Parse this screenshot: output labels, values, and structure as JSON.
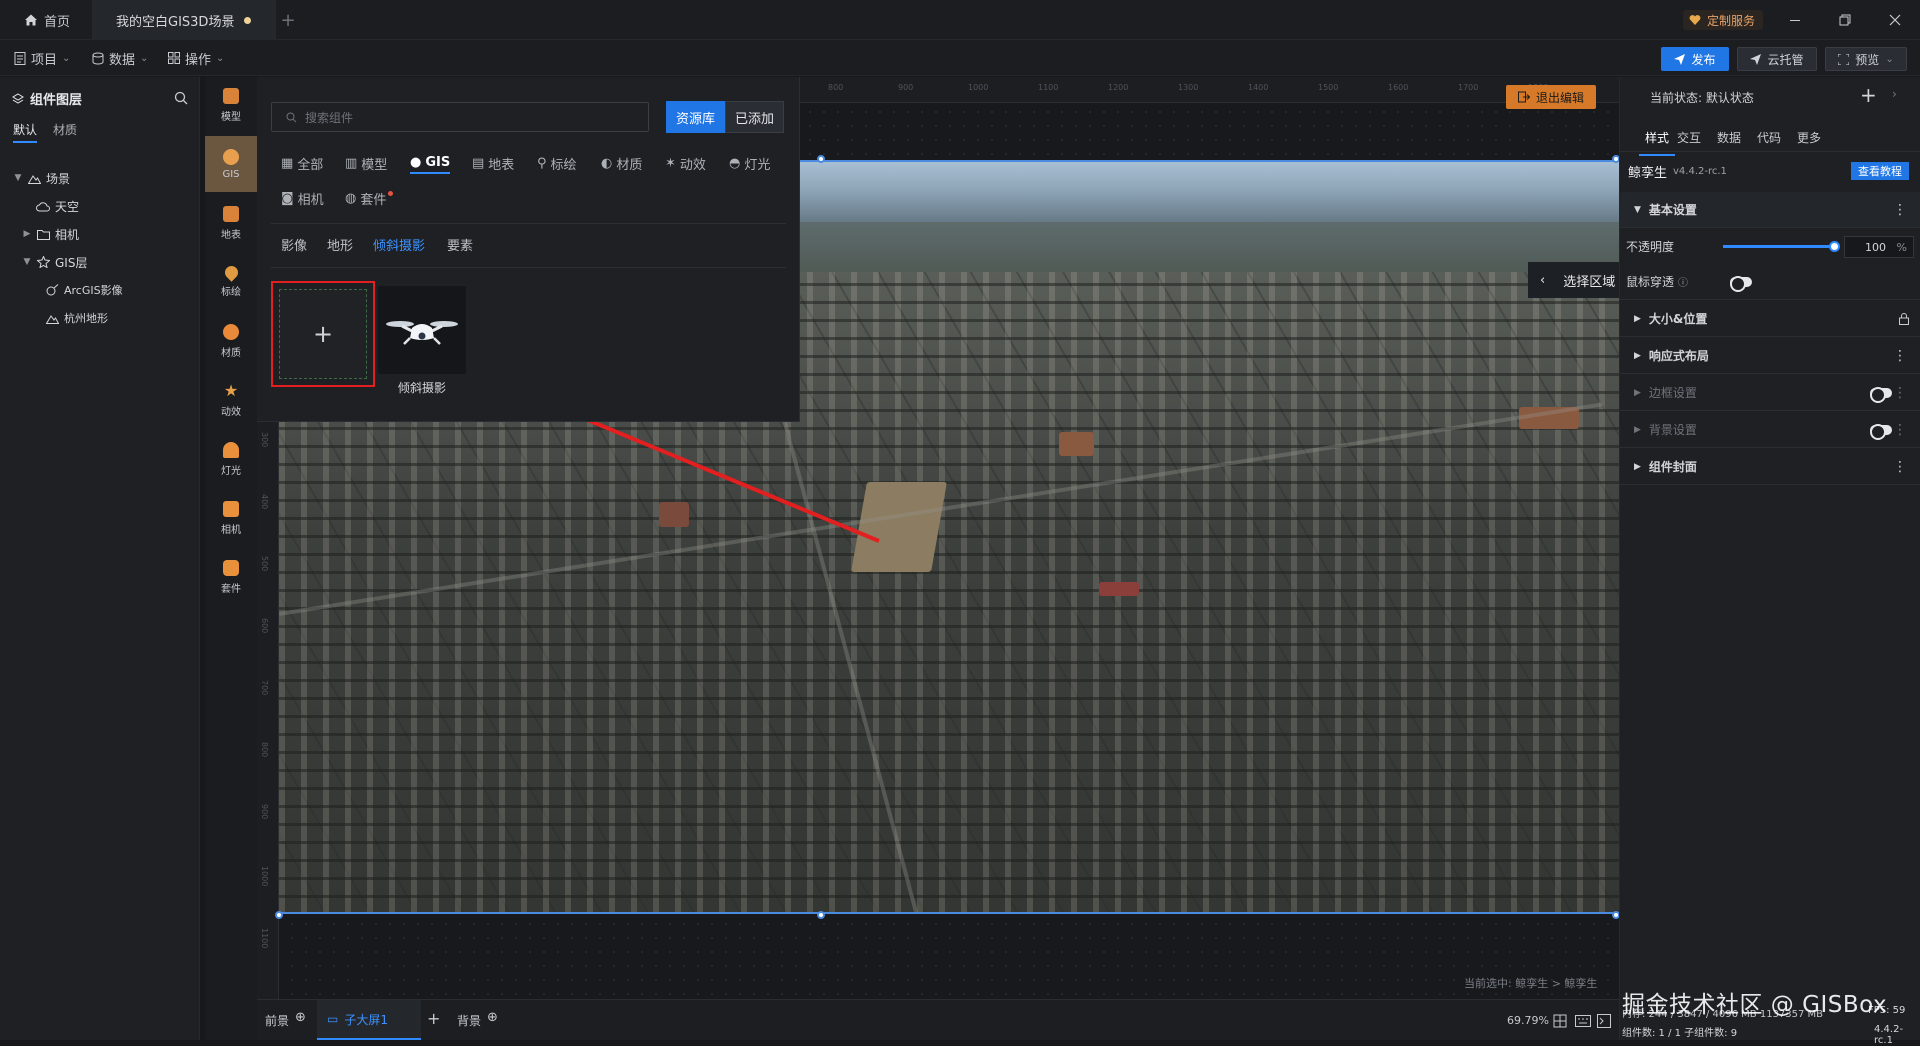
{
  "titlebar": {
    "home_tab": "首页",
    "scene_tab": "我的空白GIS3D场景",
    "custom_service": "定制服务"
  },
  "menubar": {
    "project": "项目",
    "data": "数据",
    "ops": "操作",
    "publish": "发布",
    "cloud": "云托管",
    "preview": "预览"
  },
  "layers": {
    "title": "组件图层",
    "tabs": [
      "默认",
      "材质"
    ],
    "tree": [
      "场景",
      "天空",
      "相机",
      "GIS层",
      "ArcGIS影像",
      "杭州地形"
    ]
  },
  "iconbar": [
    "模型",
    "GIS",
    "地表",
    "标绘",
    "材质",
    "动效",
    "灯光",
    "相机",
    "套件"
  ],
  "palette": {
    "search_placeholder": "搜索组件",
    "lib_btn": "资源库",
    "added_btn": "已添加",
    "categories": [
      "全部",
      "模型",
      "GIS",
      "地表",
      "标绘",
      "材质",
      "动效",
      "灯光",
      "相机",
      "套件"
    ],
    "subtabs": [
      "影像",
      "地形",
      "倾斜摄影",
      "要素"
    ],
    "drone_label": "倾斜摄影"
  },
  "canvas": {
    "exit_edit": "退出编辑",
    "select_region": "选择区域",
    "selected_info": "当前选中: 鲸孪生 > 鲸孪生",
    "ruler_top": [
      "800",
      "900",
      "1000",
      "1100",
      "1200",
      "1300",
      "1400",
      "1500",
      "1600",
      "1700",
      "1800"
    ],
    "ruler_left": [
      "300",
      "400",
      "500",
      "600",
      "700",
      "800",
      "900",
      "1000",
      "1100"
    ]
  },
  "bottombar": {
    "front": "前景",
    "child_screen": "子大屏1",
    "back": "背景",
    "zoom": "69.79%"
  },
  "props": {
    "state": "当前状态: 默认状态",
    "tabs": [
      "样式",
      "交互",
      "数据",
      "代码",
      "更多"
    ],
    "app_name": "鲸孪生",
    "version": "v4.4.2-rc.1",
    "tutorial": "查看教程",
    "basic": "基本设置",
    "opacity_label": "不透明度",
    "opacity_value": "100",
    "opacity_unit": "%",
    "opacity": 1.0,
    "mouse_through": "鼠标穿透",
    "size_pos": "大小&位置",
    "responsive": "响应式布局",
    "border": "边框设置",
    "background": "背景设置",
    "cover": "组件封面"
  },
  "footer": {
    "watermark": "掘金技术社区 @ GISBox",
    "stats_line": "内存: 244 / 3847 / 4096 MB 1137357 MB",
    "fps": "FPS: 59",
    "count_line": "组件数: 1 / 1  子组件数: 9",
    "version": "4.4.2-rc.1"
  },
  "colors": {
    "accent": "#2176e6",
    "highlight": "#e31f1f",
    "exit": "#d67a2a"
  }
}
